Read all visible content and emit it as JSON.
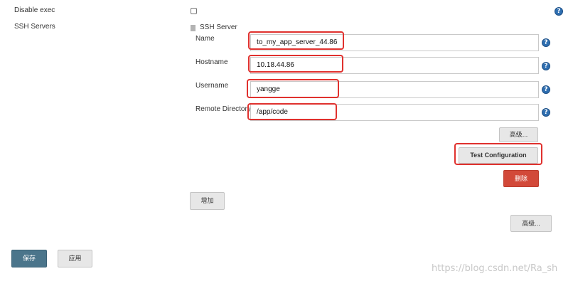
{
  "fields": {
    "disable_exec_label": "Disable exec",
    "ssh_servers_label": "SSH Servers"
  },
  "ssh_server": {
    "heading": "SSH Server",
    "name_label": "Name",
    "name_value": "to_my_app_server_44.86",
    "hostname_label": "Hostname",
    "hostname_value": "10.18.44.86",
    "username_label": "Username",
    "username_value": "yangge",
    "remote_dir_label": "Remote Directory",
    "remote_dir_value": "/app/code",
    "advanced_label": "高级...",
    "test_config_label": "Test Configuration",
    "delete_label": "删除"
  },
  "add_label": "增加",
  "advanced_outer_label": "高级...",
  "footer": {
    "save_label": "保存",
    "apply_label": "应用"
  },
  "help_glyph": "?",
  "watermark": "https://blog.csdn.net/Ra_sh"
}
